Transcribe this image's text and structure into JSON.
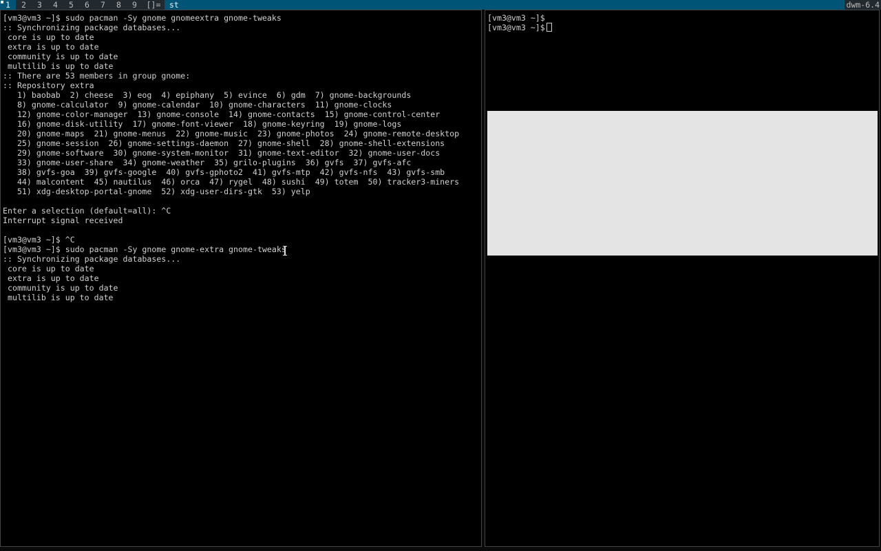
{
  "bar": {
    "tags": [
      "1",
      "2",
      "3",
      "4",
      "5",
      "6",
      "7",
      "8",
      "9"
    ],
    "selected_tag": "1",
    "layout_symbol": "[]=",
    "window_title": "st",
    "status": "dwm-6.4",
    "colors": {
      "bar_bg": "#22292f",
      "accent": "#005577",
      "fg": "#bbbbbb",
      "sel_fg": "#eeeeee"
    }
  },
  "left_terminal": {
    "lines": [
      "[vm3@vm3 ~]$ sudo pacman -Sy gnome gnomeextra gnome-tweaks",
      ":: Synchronizing package databases...",
      " core is up to date",
      " extra is up to date",
      " community is up to date",
      " multilib is up to date",
      ":: There are 53 members in group gnome:",
      ":: Repository extra",
      "   1) baobab  2) cheese  3) eog  4) epiphany  5) evince  6) gdm  7) gnome-backgrounds",
      "   8) gnome-calculator  9) gnome-calendar  10) gnome-characters  11) gnome-clocks",
      "   12) gnome-color-manager  13) gnome-console  14) gnome-contacts  15) gnome-control-center",
      "   16) gnome-disk-utility  17) gnome-font-viewer  18) gnome-keyring  19) gnome-logs",
      "   20) gnome-maps  21) gnome-menus  22) gnome-music  23) gnome-photos  24) gnome-remote-desktop",
      "   25) gnome-session  26) gnome-settings-daemon  27) gnome-shell  28) gnome-shell-extensions",
      "   29) gnome-software  30) gnome-system-monitor  31) gnome-text-editor  32) gnome-user-docs",
      "   33) gnome-user-share  34) gnome-weather  35) grilo-plugins  36) gvfs  37) gvfs-afc",
      "   38) gvfs-goa  39) gvfs-google  40) gvfs-gphoto2  41) gvfs-mtp  42) gvfs-nfs  43) gvfs-smb",
      "   44) malcontent  45) nautilus  46) orca  47) rygel  48) sushi  49) totem  50) tracker3-miners",
      "   51) xdg-desktop-portal-gnome  52) xdg-user-dirs-gtk  53) yelp",
      "",
      "Enter a selection (default=all): ^C",
      "Interrupt signal received",
      "",
      "[vm3@vm3 ~]$ ^C",
      "[vm3@vm3 ~]$ sudo pacman -Sy gnome gnome-extra gnome-tweaks",
      ":: Synchronizing package databases...",
      " core is up to date",
      " extra is up to date",
      " community is up to date",
      " multilib is up to date"
    ]
  },
  "right_terminal": {
    "lines": [
      "[vm3@vm3 ~]$",
      "[vm3@vm3 ~]$"
    ]
  }
}
